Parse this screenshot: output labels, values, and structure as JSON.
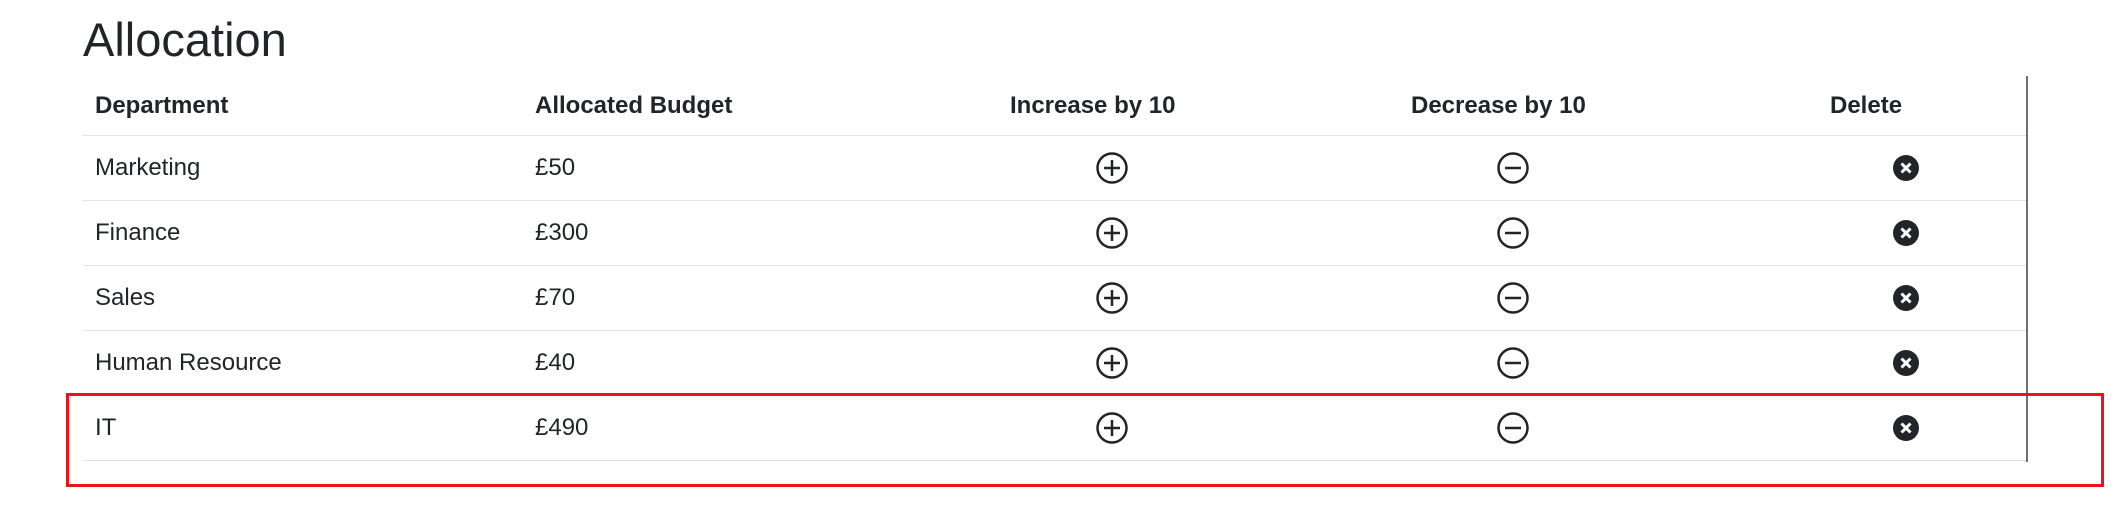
{
  "page": {
    "title": "Allocation"
  },
  "table": {
    "headers": {
      "department": "Department",
      "budget": "Allocated Budget",
      "increase": "Increase by 10",
      "decrease": "Decrease by 10",
      "delete": "Delete"
    },
    "rows": [
      {
        "department": "Marketing",
        "budget": "£50"
      },
      {
        "department": "Finance",
        "budget": "£300"
      },
      {
        "department": "Sales",
        "budget": "£70"
      },
      {
        "department": "Human Resource",
        "budget": "£40"
      },
      {
        "department": "IT",
        "budget": "£490"
      }
    ]
  },
  "icons": {
    "increase": "plus-circle-icon",
    "decrease": "minus-circle-icon",
    "delete": "x-circle-filled-icon"
  },
  "colors": {
    "text": "#212529",
    "highlight": "#e8161c",
    "divider": "#dee2e6"
  }
}
